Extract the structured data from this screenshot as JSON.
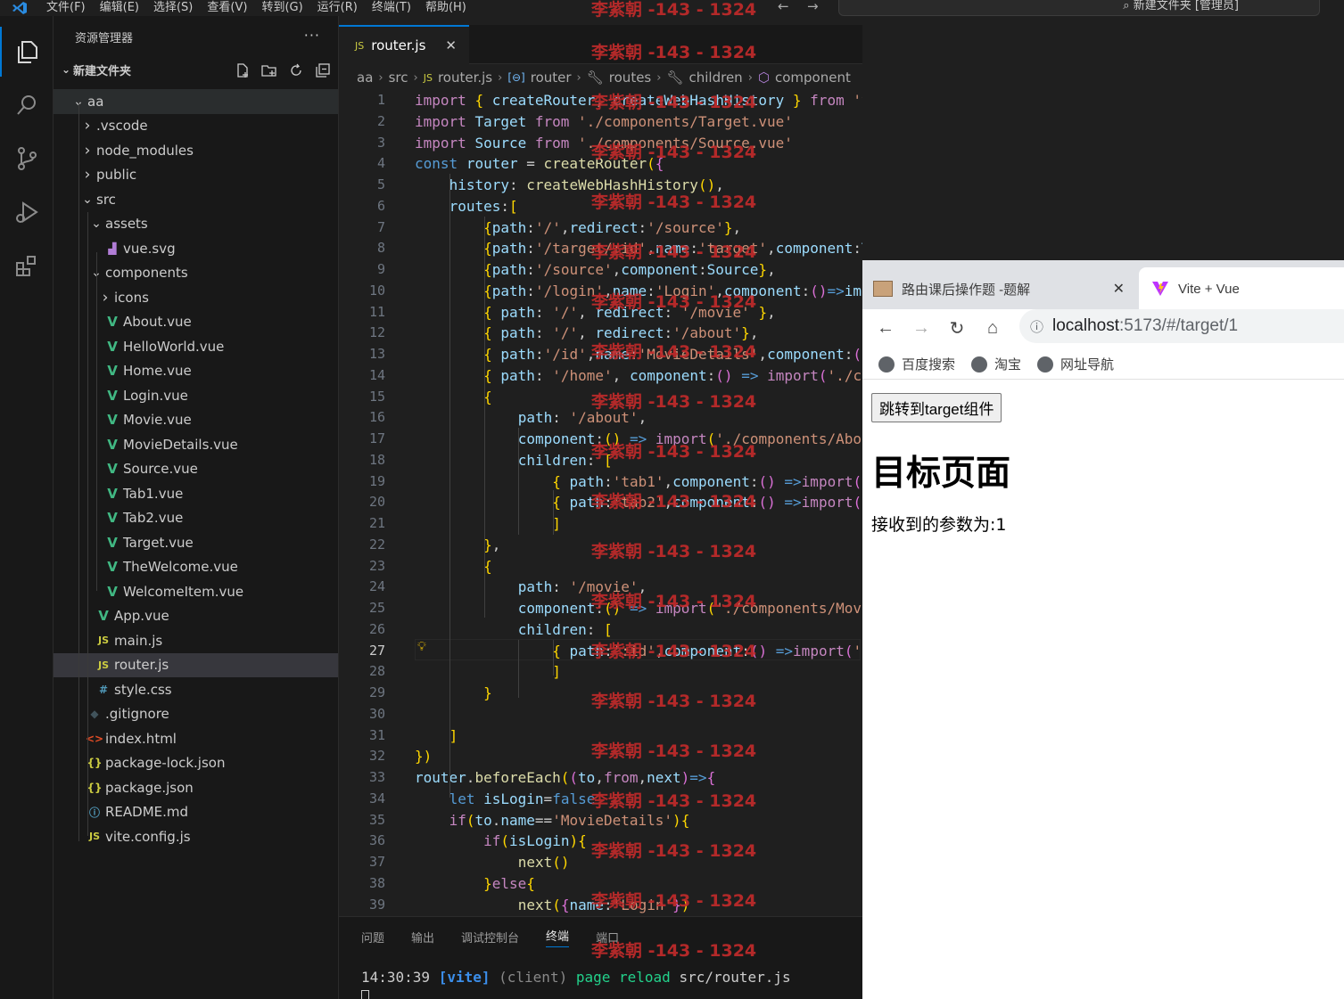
{
  "menubar": {
    "items": [
      "文件(F)",
      "编辑(E)",
      "选择(S)",
      "查看(V)",
      "转到(G)",
      "运行(R)",
      "终端(T)",
      "帮助(H)"
    ],
    "search_text": "新建文件夹 [管理员]"
  },
  "sidebar": {
    "title": "资源管理器",
    "folder": "新建文件夹",
    "tree": [
      {
        "label": "aa",
        "type": "folder-open",
        "depth": 1
      },
      {
        "label": ".vscode",
        "type": "folder",
        "depth": 2
      },
      {
        "label": "node_modules",
        "type": "folder",
        "depth": 2
      },
      {
        "label": "public",
        "type": "folder",
        "depth": 2
      },
      {
        "label": "src",
        "type": "folder-open",
        "depth": 2
      },
      {
        "label": "assets",
        "type": "folder-open",
        "depth": 3
      },
      {
        "label": "vue.svg",
        "type": "svg",
        "depth": 4
      },
      {
        "label": "components",
        "type": "folder-open",
        "depth": 3
      },
      {
        "label": "icons",
        "type": "folder",
        "depth": 4
      },
      {
        "label": "About.vue",
        "type": "vue",
        "depth": 4
      },
      {
        "label": "HelloWorld.vue",
        "type": "vue",
        "depth": 4
      },
      {
        "label": "Home.vue",
        "type": "vue",
        "depth": 4
      },
      {
        "label": "Login.vue",
        "type": "vue",
        "depth": 4
      },
      {
        "label": "Movie.vue",
        "type": "vue",
        "depth": 4
      },
      {
        "label": "MovieDetails.vue",
        "type": "vue",
        "depth": 4
      },
      {
        "label": "Source.vue",
        "type": "vue",
        "depth": 4
      },
      {
        "label": "Tab1.vue",
        "type": "vue",
        "depth": 4
      },
      {
        "label": "Tab2.vue",
        "type": "vue",
        "depth": 4
      },
      {
        "label": "Target.vue",
        "type": "vue",
        "depth": 4
      },
      {
        "label": "TheWelcome.vue",
        "type": "vue",
        "depth": 4
      },
      {
        "label": "WelcomeItem.vue",
        "type": "vue",
        "depth": 4
      },
      {
        "label": "App.vue",
        "type": "vue",
        "depth": 3
      },
      {
        "label": "main.js",
        "type": "js",
        "depth": 3
      },
      {
        "label": "router.js",
        "type": "js",
        "depth": 3,
        "selected": true
      },
      {
        "label": "style.css",
        "type": "css",
        "depth": 3
      },
      {
        "label": ".gitignore",
        "type": "git",
        "depth": 2
      },
      {
        "label": "index.html",
        "type": "html",
        "depth": 2
      },
      {
        "label": "package-lock.json",
        "type": "json",
        "depth": 2
      },
      {
        "label": "package.json",
        "type": "json",
        "depth": 2
      },
      {
        "label": "README.md",
        "type": "info",
        "depth": 2
      },
      {
        "label": "vite.config.js",
        "type": "js",
        "depth": 2
      }
    ]
  },
  "editor": {
    "tab_label": "router.js",
    "tab_icon": "JS",
    "breadcrumb": [
      "aa",
      "src",
      "router.js",
      "router",
      "routes",
      "children",
      "component"
    ],
    "current_line": 27,
    "lines": [
      "import { createRouter, createWebHashHistory } from 'vue-router'",
      "import Target from './components/Target.vue'",
      "import Source from './components/Source.vue'",
      "const router = createRouter({",
      "    history: createWebHashHistory(),",
      "    routes:[",
      "        {path:'/',redirect:'/source'},",
      "        {path:'/target/:id',name:'target',component:Target},",
      "        {path:'/source',component:Source},",
      "        {path:'/login',name:'Login',component:()=>im",
      "        { path: '/', redirect: '/movie' },",
      "        { path: '/', redirect:'/about'},",
      "        { path:'/id',name:'MovieDetails',component:(",
      "        { path: '/home', component:() => import('./c",
      "        {",
      "            path: '/about',",
      "            component:() => import('./components/Abo",
      "            children: [",
      "                { path:'tab1',component:() =>import(",
      "                { path:'tab2',component:() =>import(",
      "                ]",
      "        },",
      "        {",
      "            path: '/movie',",
      "            component:() => import('./components/Mov",
      "            children: [",
      "                { path:':id',component:() =>import('",
      "                ]",
      "        }",
      "",
      "    ]",
      "})",
      "router.beforeEach((to,from,next)=>{",
      "    let isLogin=false",
      "    if(to.name=='MovieDetails'){",
      "        if(isLogin){",
      "            next()",
      "        }else{",
      "            next({name:'Login'})"
    ]
  },
  "panel": {
    "tabs": [
      "问题",
      "输出",
      "调试控制台",
      "终端",
      "端口"
    ],
    "active_tab": "终端",
    "terminal": {
      "time": "14:30:39",
      "tag": "[vite]",
      "client": "(client)",
      "msg": "page reload",
      "file": "src/router.js"
    }
  },
  "watermark": "李紫朝 -143 - 1324",
  "browser": {
    "tabs": [
      "路由课后操作题 -题解",
      "Vite + Vue"
    ],
    "url_host": "localhost",
    "url_rest": ":5173/#/target/1",
    "bookmarks": [
      "百度搜索",
      "淘宝",
      "网址导航"
    ],
    "page": {
      "button": "跳转到target组件",
      "title": "目标页面",
      "param_text": "接收到的参数为:1"
    }
  }
}
